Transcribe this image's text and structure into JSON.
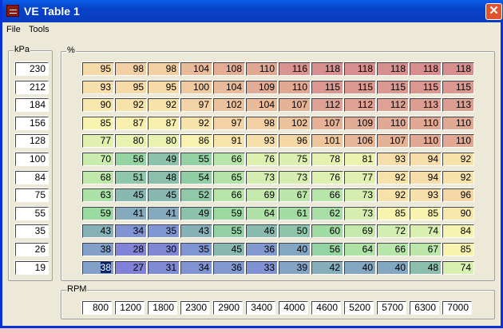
{
  "window": {
    "title": "VE Table 1",
    "close": "✕"
  },
  "menu": [
    "File",
    "Tools"
  ],
  "kpa": {
    "label": "kPa",
    "values": [
      "230",
      "212",
      "184",
      "156",
      "128",
      "100",
      "84",
      "75",
      "55",
      "35",
      "26",
      "19"
    ]
  },
  "ve": {
    "label": "%",
    "rows": [
      [
        95,
        98,
        98,
        104,
        108,
        110,
        116,
        118,
        118,
        118,
        118,
        118
      ],
      [
        93,
        95,
        95,
        100,
        104,
        109,
        110,
        115,
        115,
        115,
        115,
        115
      ],
      [
        90,
        92,
        92,
        97,
        102,
        104,
        107,
        112,
        112,
        112,
        113,
        113
      ],
      [
        85,
        87,
        87,
        92,
        97,
        98,
        102,
        107,
        109,
        110,
        110,
        110
      ],
      [
        77,
        80,
        80,
        86,
        91,
        93,
        96,
        101,
        106,
        107,
        110,
        110
      ],
      [
        70,
        56,
        49,
        55,
        66,
        76,
        75,
        78,
        81,
        93,
        94,
        92
      ],
      [
        68,
        51,
        48,
        54,
        65,
        73,
        73,
        76,
        77,
        92,
        94,
        92
      ],
      [
        63,
        45,
        45,
        52,
        66,
        69,
        67,
        66,
        73,
        92,
        93,
        96
      ],
      [
        59,
        41,
        41,
        49,
        59,
        64,
        61,
        62,
        73,
        85,
        85,
        90
      ],
      [
        43,
        34,
        35,
        43,
        55,
        46,
        50,
        60,
        69,
        72,
        74,
        84
      ],
      [
        38,
        28,
        30,
        35,
        45,
        36,
        40,
        56,
        64,
        66,
        67,
        85
      ],
      [
        38,
        27,
        31,
        34,
        36,
        33,
        39,
        42,
        40,
        40,
        48,
        74
      ]
    ],
    "selected": [
      11,
      0
    ]
  },
  "rpm": {
    "label": "RPM",
    "values": [
      "800",
      "1200",
      "1800",
      "2300",
      "2900",
      "3400",
      "4000",
      "4600",
      "5200",
      "5700",
      "6300",
      "7000"
    ]
  }
}
